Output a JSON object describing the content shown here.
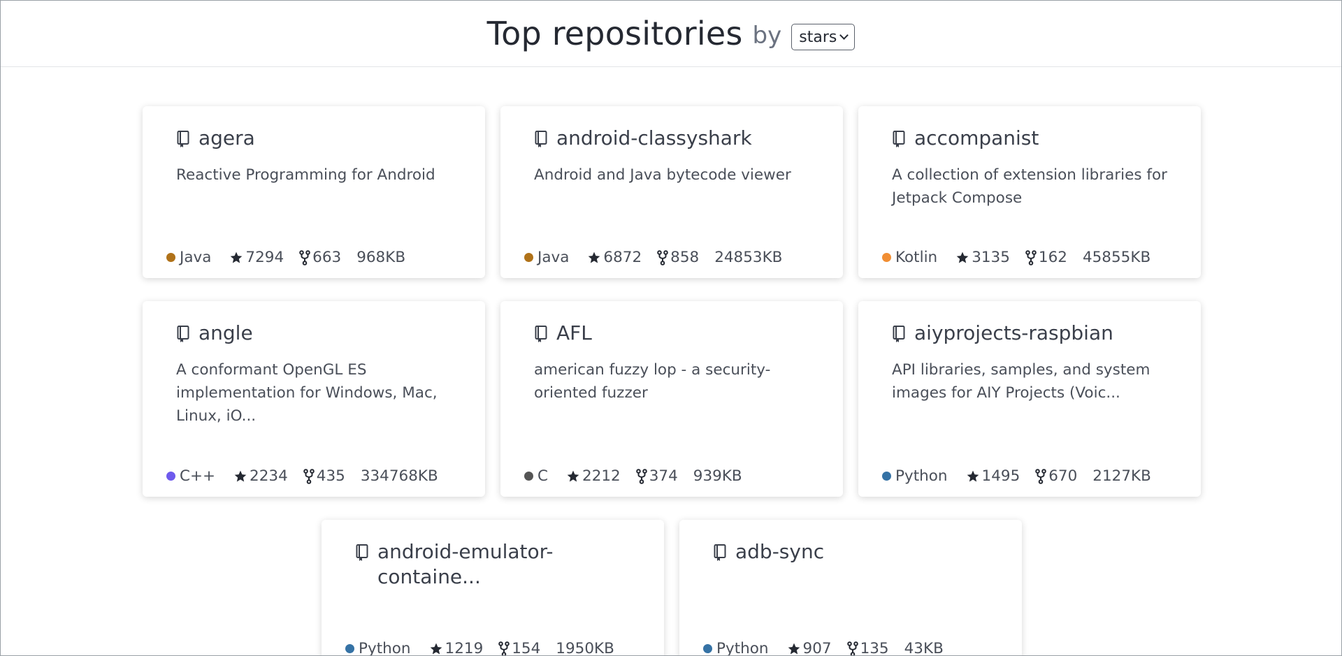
{
  "header": {
    "title": "Top repositories",
    "by": "by",
    "sort_value": "stars"
  },
  "repos": [
    {
      "name": "agera",
      "description": "Reactive Programming for Android",
      "language": "Java",
      "lang_color": "#b07219",
      "stars": "7294",
      "forks": "663",
      "size": "968KB"
    },
    {
      "name": "android-classyshark",
      "description": "Android and Java bytecode viewer",
      "language": "Java",
      "lang_color": "#b07219",
      "stars": "6872",
      "forks": "858",
      "size": "24853KB"
    },
    {
      "name": "accompanist",
      "description": "A collection of extension libraries for Jetpack Compose",
      "language": "Kotlin",
      "lang_color": "#f18e33",
      "stars": "3135",
      "forks": "162",
      "size": "45855KB"
    },
    {
      "name": "angle",
      "description": "A conformant OpenGL ES implementation for Windows, Mac, Linux, iO...",
      "language": "C++",
      "lang_color": "#6e5aed",
      "stars": "2234",
      "forks": "435",
      "size": "334768KB"
    },
    {
      "name": "AFL",
      "description": "american fuzzy lop - a security-oriented fuzzer",
      "language": "C",
      "lang_color": "#555555",
      "stars": "2212",
      "forks": "374",
      "size": "939KB"
    },
    {
      "name": "aiyprojects-raspbian",
      "description": "API libraries, samples, and system images for AIY Projects (Voic...",
      "language": "Python",
      "lang_color": "#3572a5",
      "stars": "1495",
      "forks": "670",
      "size": "2127KB"
    },
    {
      "name": "android-emulator-containe...",
      "description": "",
      "language": "Python",
      "lang_color": "#3572a5",
      "stars": "1219",
      "forks": "154",
      "size": "1950KB"
    },
    {
      "name": "adb-sync",
      "description": "",
      "language": "Python",
      "lang_color": "#3572a5",
      "stars": "907",
      "forks": "135",
      "size": "43KB"
    }
  ]
}
